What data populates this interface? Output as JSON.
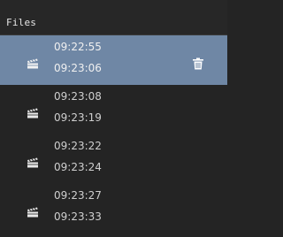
{
  "header": {
    "title": "Files"
  },
  "files": [
    {
      "start": "09:22:55",
      "end": "09:23:06",
      "selected": true
    },
    {
      "start": "09:23:08",
      "end": "09:23:19",
      "selected": false
    },
    {
      "start": "09:23:22",
      "end": "09:23:24",
      "selected": false
    },
    {
      "start": "09:23:27",
      "end": "09:23:33",
      "selected": false
    }
  ],
  "icons": {
    "file_icon": "clapperboard-icon",
    "delete_icon": "trash-icon"
  },
  "colors": {
    "background": "#242424",
    "selected_row": "#6f87a5",
    "text": "#cfcfcf"
  }
}
